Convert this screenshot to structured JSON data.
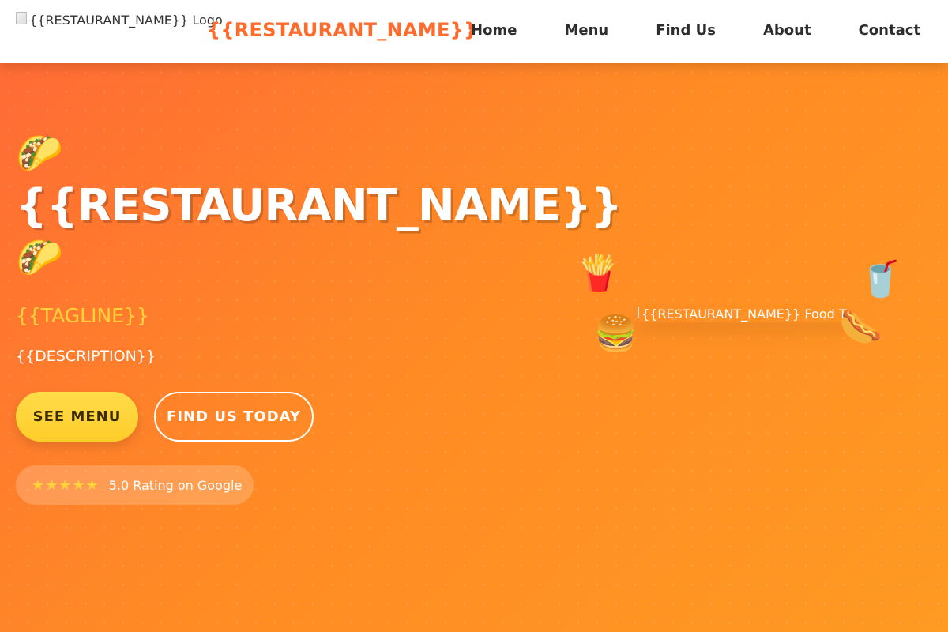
{
  "header": {
    "logo_alt": "{{RESTAURANT_NAME}} Logo",
    "brand": "{{RESTAURANT_NAME}}",
    "nav": [
      {
        "label": "Home"
      },
      {
        "label": "Menu"
      },
      {
        "label": "Find Us"
      },
      {
        "label": "About"
      },
      {
        "label": "Contact"
      }
    ]
  },
  "hero": {
    "emoji_top": "🌮",
    "title": "{{RESTAURANT_NAME}}",
    "emoji_bottom": "🌮",
    "tagline": "{{TAGLINE}}",
    "description": "{{DESCRIPTION}}",
    "primary_button": "SEE MENU",
    "secondary_button": "FIND US TODAY",
    "rating": {
      "stars": "★★★★★",
      "text": "5.0 Rating on Google",
      "value": 5.0
    },
    "truck_image_alt": "{{RESTAURANT_NAME}} Food Truck",
    "floating_emojis": {
      "fries": "🍟",
      "burger": "🍔",
      "drink": "🥤",
      "hotdog": "🌭"
    }
  },
  "colors": {
    "brand": "#ff6b2b",
    "hero_start": "#ff6b35",
    "hero_end": "#ff9a22",
    "accent_yellow": "#ffd43b",
    "nav_text": "#2d2d2d"
  }
}
